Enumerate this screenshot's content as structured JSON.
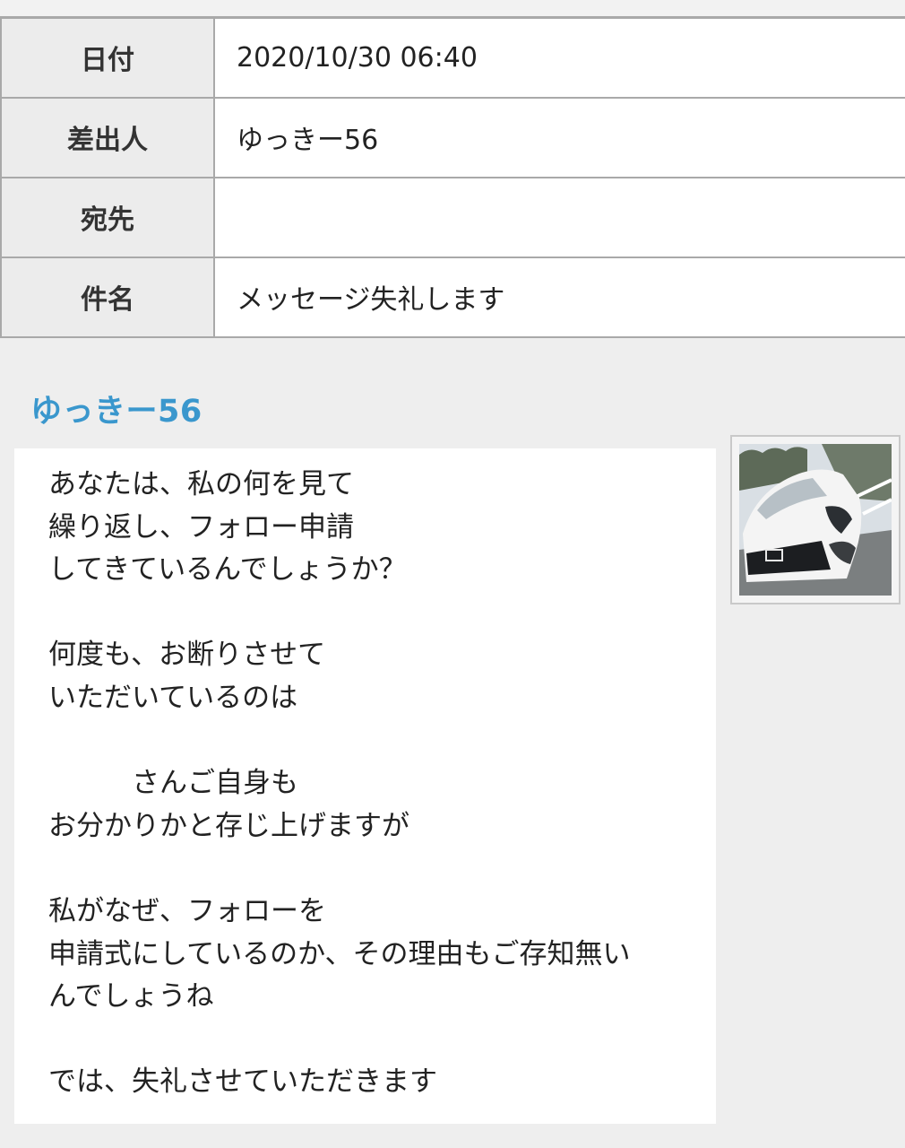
{
  "header": {
    "rows": [
      {
        "label": "日付",
        "value": "2020/10/30 06:40"
      },
      {
        "label": "差出人",
        "value": "ゆっきー56"
      },
      {
        "label": "宛先",
        "value": ""
      },
      {
        "label": "件名",
        "value": "メッセージ失礼します"
      }
    ]
  },
  "message": {
    "sender": "ゆっきー56",
    "lines": [
      "あなたは、私の何を見て",
      "繰り返し、フォロー申請",
      "してきているんでしょうか？",
      "",
      "何度も、お断りさせて",
      "いただいているのは",
      "",
      "　　　さんご自身も",
      "お分かりかと存じ上げますが",
      "",
      "私がなぜ、フォローを",
      "申請式にしているのか、その理由もご存知無い",
      "んでしょうね",
      "",
      "では、失礼させていただきます"
    ]
  },
  "avatar": {
    "icon": "car-photo-icon",
    "colors": {
      "car": "#f4f4f4",
      "sky": "#d9dfe4",
      "trees": "#5d6a58",
      "road": "#7b7f80"
    }
  },
  "colors": {
    "accent": "#3a97cd",
    "label_bg": "#ececec",
    "border": "#a9a9a9",
    "page_bg": "#eeeeee"
  }
}
